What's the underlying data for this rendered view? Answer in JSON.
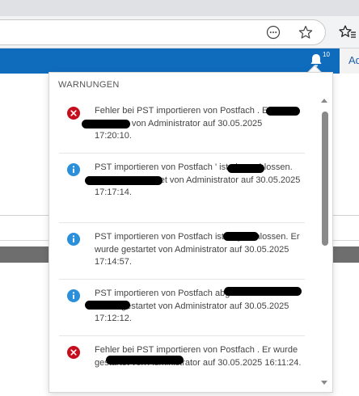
{
  "browser": {
    "reader_icon": "more-circle-icon",
    "favorite_icon": "star-icon",
    "favorites_icon": "favorites-star-icon"
  },
  "header": {
    "bell_icon": "bell-icon",
    "notification_count": "10",
    "right_text": "Ad",
    "accent_color": "#0f6cbd"
  },
  "notifications": {
    "title": "WARNUNGEN",
    "items": [
      {
        "type": "error",
        "icon": "error-icon",
        "text": "Fehler bei PST importieren von Postfach  . Er wurde gestartet von Administrator auf 30.05.2025 17:20:10."
      },
      {
        "type": "info",
        "icon": "info-icon",
        "text": "PST importieren von Postfach  ' ist abgeschlossen. Er wurde gestartet von Administrator auf 30.05.2025 17:17:14."
      },
      {
        "type": "info",
        "icon": "info-icon",
        "text": "PST importieren von Postfach  ist abgeschlossen. Er wurde gestartet von Administrator auf 30.05.2025 17:14:57."
      },
      {
        "type": "info",
        "icon": "info-icon",
        "text": "PST importieren von Postfach  abgeschlossen. Er wurde gestartet von Administrator auf 30.05.2025 17:12:12."
      },
      {
        "type": "error",
        "icon": "error-icon",
        "text": "Fehler bei PST importieren von Postfach  . Er wurde gestartet von Administrator auf 30.05.2025 16:11:24."
      }
    ],
    "colors": {
      "error": "#c50f1f",
      "info": "#2b8fd9"
    }
  }
}
